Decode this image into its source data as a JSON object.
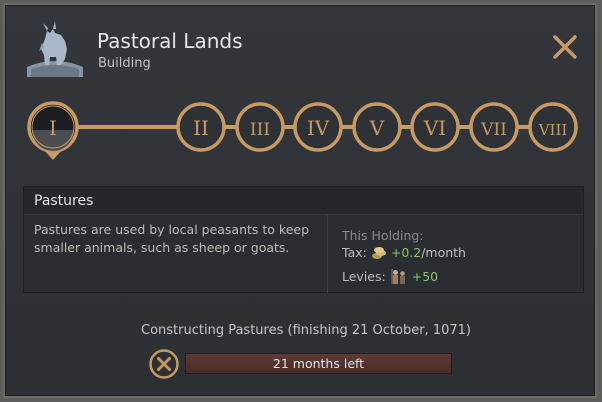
{
  "header": {
    "title": "Pastoral Lands",
    "subtitle": "Building"
  },
  "tiers": [
    "I",
    "II",
    "III",
    "IV",
    "V",
    "VI",
    "VII",
    "VIII"
  ],
  "selected_tier": "I",
  "info": {
    "name": "Pastures",
    "description": "Pastures are used by local peasants to keep smaller animals, such as sheep or goats.",
    "holding_label": "This Holding:",
    "tax_label": "Tax:",
    "tax_value": "+0.2",
    "tax_unit": "/month",
    "levies_label": "Levies:",
    "levies_value": "+50"
  },
  "construction": {
    "status_text": "Constructing Pastures (finishing 21 October, 1071)",
    "time_left": "21 months left"
  },
  "colors": {
    "gold": "#c69a63",
    "positive": "#8ec26b",
    "progress_fill": "#5f3a34"
  },
  "icons": {
    "emblem": "goat-emblem-icon",
    "close": "close-icon",
    "cancel": "cancel-icon",
    "tax": "gold-coins-icon",
    "levies": "soldiers-icon"
  }
}
